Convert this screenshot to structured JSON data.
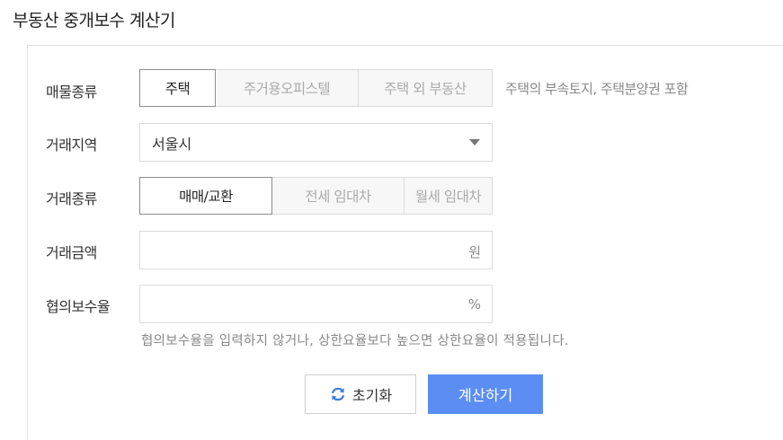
{
  "page": {
    "title": "부동산 중개보수 계산기"
  },
  "form": {
    "property_type": {
      "label": "매물종류",
      "options": [
        "주택",
        "주거용오피스텔",
        "주택 외 부동산"
      ],
      "selected": "주택",
      "note": "주택의 부속토지, 주택분양권 포함"
    },
    "region": {
      "label": "거래지역",
      "value": "서울시"
    },
    "transaction_type": {
      "label": "거래종류",
      "options": [
        "매매/교환",
        "전세 임대차",
        "월세 임대차"
      ],
      "selected": "매매/교환"
    },
    "amount": {
      "label": "거래금액",
      "value": "",
      "unit": "원"
    },
    "rate": {
      "label": "협의보수율",
      "value": "",
      "unit": "%",
      "hint": "협의보수율을 입력하지 않거나, 상한요율보다 높으면 상한요율이 적용됩니다."
    }
  },
  "buttons": {
    "reset_label": "초기화",
    "reset_icon": "refresh-icon",
    "calc_label": "계산하기"
  },
  "colors": {
    "accent": "#5b8df3",
    "reset_icon": "#3b7be0"
  }
}
